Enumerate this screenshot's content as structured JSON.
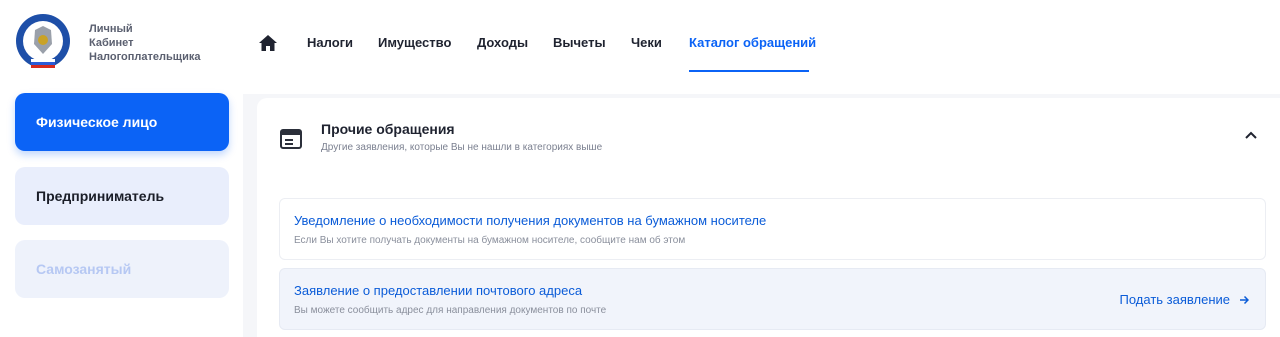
{
  "brand": {
    "line1": "Личный",
    "line2": "Кабинет",
    "line3": "Налогоплательщика"
  },
  "roles": [
    {
      "label": "Физическое лицо",
      "state": "active"
    },
    {
      "label": "Предприниматель",
      "state": "normal"
    },
    {
      "label": "Самозанятый",
      "state": "disabled"
    }
  ],
  "nav": {
    "home_icon": "home-icon",
    "items": [
      {
        "label": "Налоги"
      },
      {
        "label": "Имущество"
      },
      {
        "label": "Доходы"
      },
      {
        "label": "Вычеты"
      },
      {
        "label": "Чеки"
      },
      {
        "label": "Каталог обращений",
        "active": true
      }
    ]
  },
  "category": {
    "icon": "cabinet-icon",
    "title": "Прочие обращения",
    "subtitle": "Другие заявления, которые Вы не нашли в категориях выше",
    "collapse_icon": "chevron-up-icon"
  },
  "items": [
    {
      "title": "Уведомление о необходимости получения документов на бумажном носителе",
      "subtitle": "Если Вы хотите получать документы на бумажном носителе, сообщите нам об этом"
    },
    {
      "title": "Заявление о предоставлении почтового адреса",
      "subtitle": "Вы можете сообщить адрес для направления документов по почте",
      "action": "Подать заявление",
      "action_icon": "arrow-right-icon"
    }
  ],
  "colors": {
    "accent": "#0b63f6",
    "link": "#0b5cd8",
    "role_inactive_bg": "#e9eefc"
  }
}
